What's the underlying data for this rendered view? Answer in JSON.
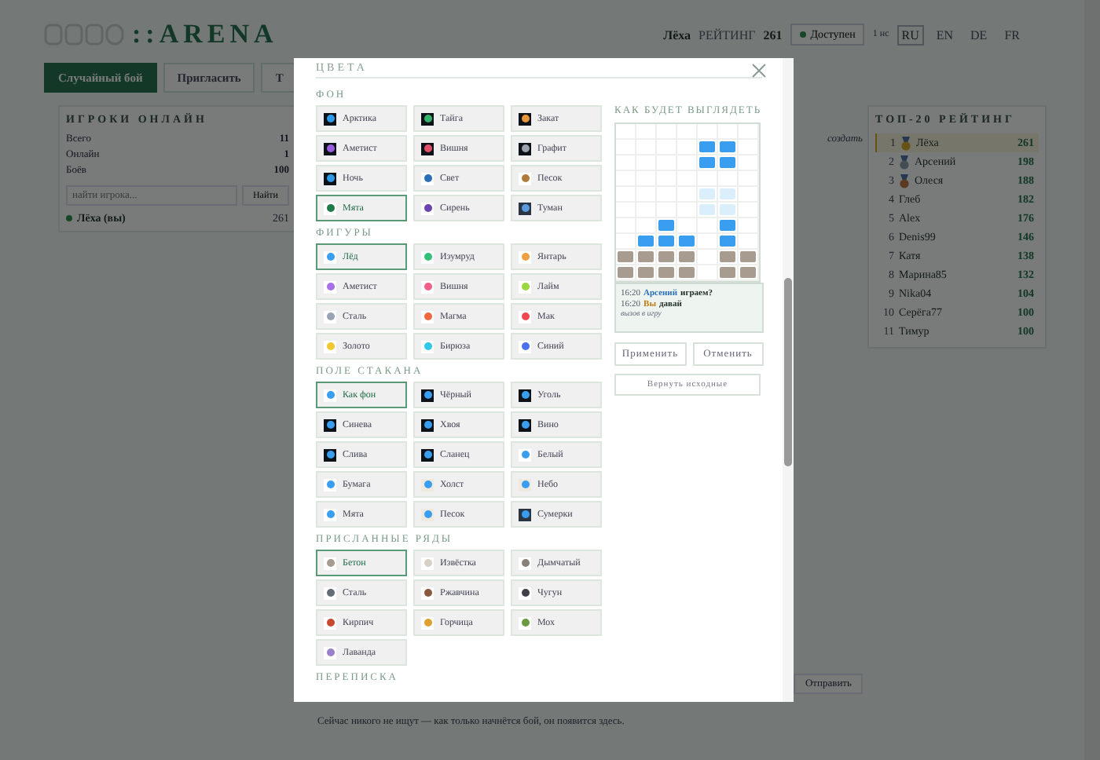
{
  "header": {
    "logo": "::ARENA",
    "user": "Лёха",
    "rating_label": "РЕЙТИНГ",
    "rating": "261",
    "status": "Доступен",
    "misc": "1 нс",
    "languages": [
      {
        "label": "RU",
        "selected": true
      },
      {
        "label": "EN",
        "selected": false
      },
      {
        "label": "DE",
        "selected": false
      },
      {
        "label": "FR",
        "selected": false
      }
    ]
  },
  "nav": [
    {
      "label": "Случайный бой",
      "selected": true
    },
    {
      "label": "Пригласить",
      "selected": false
    },
    {
      "label": "Т",
      "selected": false
    }
  ],
  "online": {
    "title": "ИГРОКИ ОНЛАЙН",
    "stats": [
      {
        "label": "Всего",
        "value": "11"
      },
      {
        "label": "Онлайн",
        "value": "1"
      },
      {
        "label": "Боёв",
        "value": "100"
      }
    ],
    "search": {
      "placeholder": "найти игрока..."
    },
    "find": "Найти",
    "players": [
      {
        "name": "Лёха (вы)",
        "rating": "261"
      }
    ]
  },
  "center": {
    "hint": "создать",
    "send": "Отправить",
    "empty": "Сейчас никого не ищут — как только начнётся бой, он появится здесь."
  },
  "top": {
    "title": "ТОП-20 РЕЙТИНГ",
    "rows": [
      {
        "rank": "1",
        "name": "Лёха",
        "score": "261",
        "selected": true,
        "kind": "gold"
      },
      {
        "rank": "2",
        "name": "Арсений",
        "score": "198",
        "selected": false,
        "kind": "silver"
      },
      {
        "rank": "3",
        "name": "Олеся",
        "score": "188",
        "selected": false,
        "kind": "bronze"
      },
      {
        "rank": "4",
        "name": "Глеб",
        "score": "182",
        "selected": false,
        "kind": "plain"
      },
      {
        "rank": "5",
        "name": "Alex",
        "score": "176",
        "selected": false,
        "kind": "plain"
      },
      {
        "rank": "6",
        "name": "Denis99",
        "score": "146",
        "selected": false,
        "kind": "plain"
      },
      {
        "rank": "7",
        "name": "Катя",
        "score": "138",
        "selected": false,
        "kind": "plain"
      },
      {
        "rank": "8",
        "name": "Марина85",
        "score": "132",
        "selected": false,
        "kind": "plain"
      },
      {
        "rank": "9",
        "name": "Nika04",
        "score": "104",
        "selected": false,
        "kind": "plain"
      },
      {
        "rank": "10",
        "name": "Серёга77",
        "score": "100",
        "selected": false,
        "kind": "plain"
      },
      {
        "rank": "11",
        "name": "Тимур",
        "score": "100",
        "selected": false,
        "kind": "plain"
      }
    ]
  },
  "modal": {
    "title": "ЦВЕТА",
    "sections": [
      {
        "title": "ФОН",
        "options": [
          {
            "label": "Арктика",
            "kind": "dark",
            "color": "#2f9be8",
            "selected": false
          },
          {
            "label": "Тайга",
            "kind": "dark",
            "color": "#35b36a",
            "selected": false
          },
          {
            "label": "Закат",
            "kind": "dark",
            "color": "#e8963a",
            "selected": false
          },
          {
            "label": "Аметист",
            "kind": "dark",
            "color": "#9b5de0",
            "selected": false
          },
          {
            "label": "Вишня",
            "kind": "dark",
            "color": "#e0506a",
            "selected": false
          },
          {
            "label": "Графит",
            "kind": "dark",
            "color": "#9aa3ab",
            "selected": false
          },
          {
            "label": "Ночь",
            "kind": "dark",
            "color": "#2f9be8",
            "selected": false
          },
          {
            "label": "Свет",
            "kind": "plain",
            "color": "#2a6fb8",
            "selected": false
          },
          {
            "label": "Песок",
            "kind": "plain",
            "color": "#b07a3a",
            "selected": false
          },
          {
            "label": "Мята",
            "kind": "plain",
            "color": "#1f7a4a",
            "selected": true
          },
          {
            "label": "Сирень",
            "kind": "plain",
            "color": "#6a45b0",
            "selected": false
          },
          {
            "label": "Туман",
            "kind": "slate",
            "color": "#5a9be0",
            "selected": false
          }
        ]
      },
      {
        "title": "ФИГУРЫ",
        "options": [
          {
            "label": "Лёд",
            "kind": "plain",
            "color": "#3a9ef0",
            "selected": true
          },
          {
            "label": "Изумруд",
            "kind": "plain",
            "color": "#35c07a",
            "selected": false
          },
          {
            "label": "Янтарь",
            "kind": "plain",
            "color": "#f0a040",
            "selected": false
          },
          {
            "label": "Аметист",
            "kind": "plain",
            "color": "#a870e8",
            "selected": false
          },
          {
            "label": "Вишня",
            "kind": "plain",
            "color": "#f0608a",
            "selected": false
          },
          {
            "label": "Лайм",
            "kind": "plain",
            "color": "#9ad840",
            "selected": false
          },
          {
            "label": "Сталь",
            "kind": "plain",
            "color": "#98a4b4",
            "selected": false
          },
          {
            "label": "Магма",
            "kind": "plain",
            "color": "#f06840",
            "selected": false
          },
          {
            "label": "Мак",
            "kind": "plain",
            "color": "#f04850",
            "selected": false
          },
          {
            "label": "Золото",
            "kind": "plain",
            "color": "#f0c830",
            "selected": false
          },
          {
            "label": "Бирюза",
            "kind": "plain",
            "color": "#30c8e8",
            "selected": false
          },
          {
            "label": "Синий",
            "kind": "plain",
            "color": "#4a70f0",
            "selected": false
          }
        ]
      },
      {
        "title": "ПОЛЕ СТАКАНА",
        "options": [
          {
            "label": "Как фон",
            "kind": "plain",
            "color": "#3a9ef0",
            "selected": true
          },
          {
            "label": "Чёрный",
            "kind": "dark",
            "color": "#3a9ef0",
            "selected": false
          },
          {
            "label": "Уголь",
            "kind": "dark",
            "color": "#3a9ef0",
            "selected": false
          },
          {
            "label": "Синева",
            "kind": "dark",
            "color": "#3a9ef0",
            "selected": false
          },
          {
            "label": "Хвоя",
            "kind": "dark",
            "color": "#3a9ef0",
            "selected": false
          },
          {
            "label": "Вино",
            "kind": "dark",
            "color": "#3a9ef0",
            "selected": false
          },
          {
            "label": "Слива",
            "kind": "dark",
            "color": "#3a9ef0",
            "selected": false
          },
          {
            "label": "Сланец",
            "kind": "dark",
            "color": "#3a9ef0",
            "selected": false
          },
          {
            "label": "Белый",
            "kind": "plain",
            "color": "#3a9ef0",
            "selected": false
          },
          {
            "label": "Бумага",
            "kind": "plain",
            "color": "#3a9ef0",
            "selected": false
          },
          {
            "label": "Холст",
            "kind": "tint",
            "color": "#3a9ef0",
            "selected": false
          },
          {
            "label": "Небо",
            "kind": "tint",
            "color": "#3a9ef0",
            "selected": false
          },
          {
            "label": "Мята",
            "kind": "plain",
            "color": "#3a9ef0",
            "selected": false
          },
          {
            "label": "Песок",
            "kind": "tint",
            "color": "#3a9ef0",
            "selected": false
          },
          {
            "label": "Сумерки",
            "kind": "slate",
            "color": "#3a9ef0",
            "selected": false
          }
        ]
      },
      {
        "title": "ПРИСЛАННЫЕ РЯДЫ",
        "options": [
          {
            "label": "Бетон",
            "kind": "plain",
            "color": "#a89c90",
            "selected": true
          },
          {
            "label": "Извёстка",
            "kind": "plain",
            "color": "#d8d0c4",
            "selected": false
          },
          {
            "label": "Дымчатый",
            "kind": "plain",
            "color": "#8a8078",
            "selected": false
          },
          {
            "label": "Сталь",
            "kind": "plain",
            "color": "#646c78",
            "selected": false
          },
          {
            "label": "Ржавчина",
            "kind": "plain",
            "color": "#8a5a40",
            "selected": false
          },
          {
            "label": "Чугун",
            "kind": "plain",
            "color": "#404048",
            "selected": false
          },
          {
            "label": "Кирпич",
            "kind": "plain",
            "color": "#c84830",
            "selected": false
          },
          {
            "label": "Горчица",
            "kind": "plain",
            "color": "#e0a030",
            "selected": false
          },
          {
            "label": "Мох",
            "kind": "plain",
            "color": "#6a9a40",
            "selected": false
          },
          {
            "label": "Лаванда",
            "kind": "plain",
            "color": "#9a80c8",
            "selected": false
          }
        ]
      },
      {
        "title": "ПЕРЕПИСКА"
      }
    ],
    "preview": {
      "title": "КАК БУДЕТ ВЫГЛЯДЕТЬ",
      "chat": [
        {
          "time": "16:20",
          "author": "Арсений",
          "text": "играем?",
          "color": "#2a6fb8"
        },
        {
          "time": "16:20",
          "author": "Вы",
          "text": "давай",
          "color": "#c07a10"
        }
      ],
      "note": "вызов в игру"
    },
    "apply": "Применить",
    "cancel": "Отменить",
    "reset": "Вернуть исходные"
  }
}
